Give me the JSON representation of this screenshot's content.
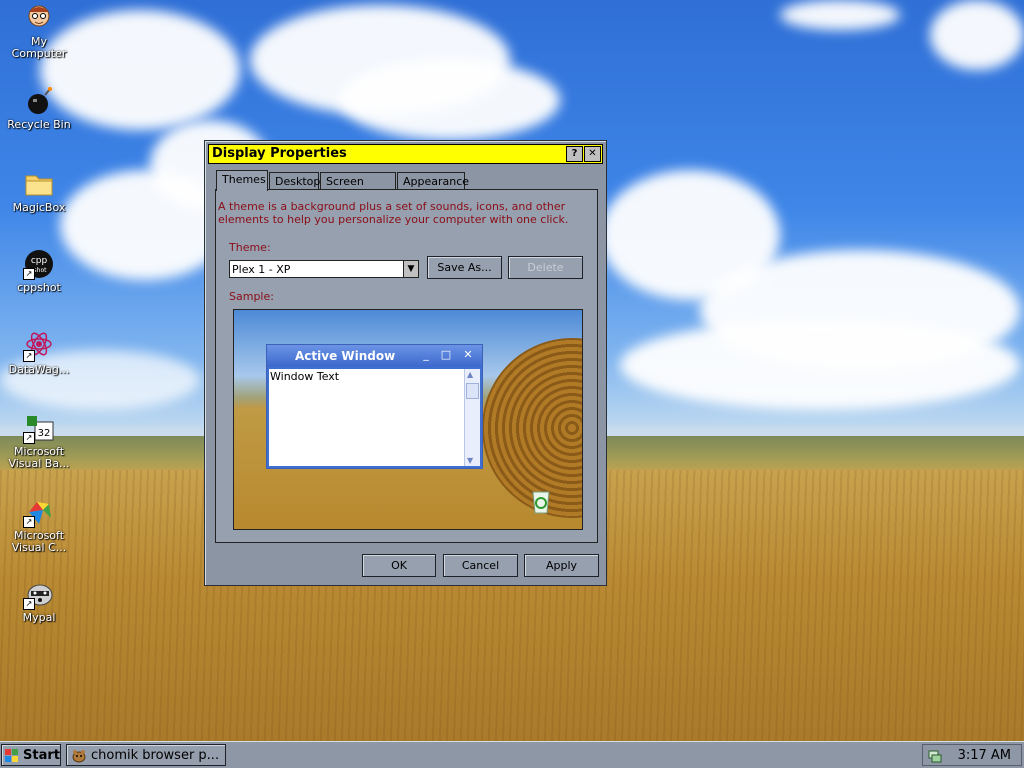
{
  "desktop": {
    "icons": [
      {
        "label": "My\nComputer",
        "icon": "my-computer-icon"
      },
      {
        "label": "Recycle Bin",
        "icon": "recycle-bin-icon"
      },
      {
        "label": "MagicBox",
        "icon": "folder-icon"
      },
      {
        "label": "cppshot",
        "icon": "cppshot-icon"
      },
      {
        "label": "DataWag...",
        "icon": "datawag-icon"
      },
      {
        "label": "Microsoft Visual Ba...",
        "icon": "visual-basic-icon"
      },
      {
        "label": "Microsoft Visual C...",
        "icon": "visual-c-icon"
      },
      {
        "label": "Mypal",
        "icon": "mypal-icon"
      }
    ]
  },
  "dialog": {
    "title": "Display Properties",
    "help_btn": "?",
    "close_btn": "✕",
    "tabs": [
      "Themes",
      "Desktop",
      "Screen Saver",
      "Appearance"
    ],
    "active_tab": "Themes",
    "description": "A theme is a background plus a set of sounds, icons, and other elements to help you personalize your computer with one click.",
    "theme_label": "Theme:",
    "theme_value": "Plex 1 - XP",
    "save_as": "Save As...",
    "delete": "Delete",
    "sample_label": "Sample:",
    "sample": {
      "window_title": "Active Window",
      "window_text": "Window Text",
      "min": "_",
      "max": "□",
      "close": "✕"
    },
    "ok": "OK",
    "cancel": "Cancel",
    "apply": "Apply"
  },
  "taskbar": {
    "start": "Start",
    "task": "chomik browser p...",
    "clock": "3:17 AM"
  },
  "colors": {
    "title_bar": "#ffff00",
    "dialog_face": "#8c95a4",
    "description_text": "#8b0d17"
  }
}
